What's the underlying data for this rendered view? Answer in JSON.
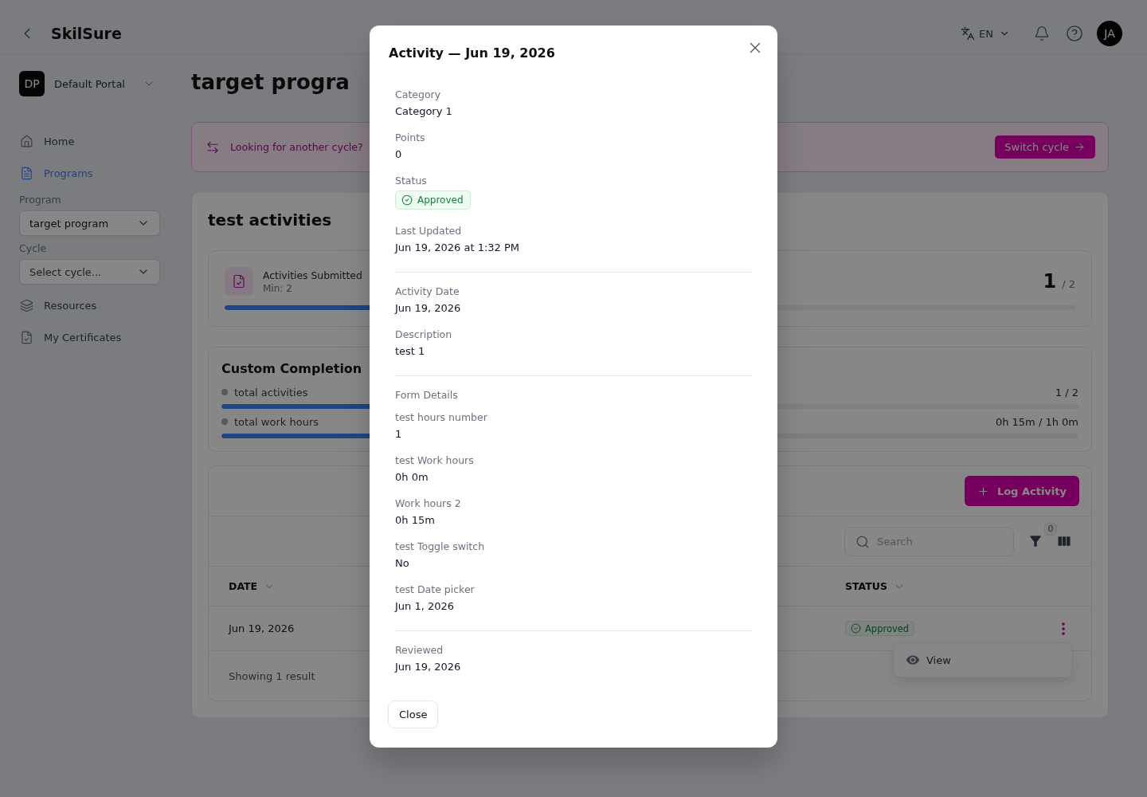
{
  "header": {
    "brand": "SkilSure",
    "language": "EN",
    "avatar": "JA"
  },
  "sidebar": {
    "portal": {
      "initials": "DP",
      "name": "Default Portal"
    },
    "items": [
      {
        "kind": "link",
        "label": "Home",
        "selected": false
      },
      {
        "kind": "link",
        "label": "Programs",
        "selected": true
      },
      {
        "kind": "select",
        "label": "Program",
        "value": "target program"
      },
      {
        "kind": "select",
        "label": "Cycle",
        "placeholder": "Select cycle..."
      },
      {
        "kind": "link",
        "label": "Resources",
        "selected": false
      },
      {
        "kind": "link",
        "label": "My Certificates",
        "selected": false
      }
    ]
  },
  "page_title": "target progra",
  "banner": {
    "text": "Looking for another cycle?",
    "button": "Switch cycle"
  },
  "section": {
    "title": "test activities",
    "requirement": {
      "title": "Activities Submitted",
      "subtitle": "Min: 2",
      "count": "1",
      "target": "/ 2",
      "level": 0.5
    },
    "custom_completion": {
      "title": "Custom Completion",
      "items": [
        {
          "label": "total activities",
          "done": false,
          "reading": "1 / 2",
          "level": 0.5
        },
        {
          "label": "total work hours",
          "done": false,
          "reading": "0h 15m / 1h 0m",
          "level": 0.25
        }
      ]
    },
    "table": {
      "button": "Log Activity",
      "search": {
        "placeholder": "Search"
      },
      "filter_count": "0",
      "columns": [
        {
          "label": "DATE"
        },
        {
          "label": "STATUS"
        }
      ],
      "rows": [
        {
          "date": "Jun 19, 2026",
          "status": "Approved"
        }
      ],
      "row_menu": [
        "View"
      ],
      "footer": "Showing 1 result"
    }
  },
  "dialog": {
    "title": "Activity — Jun 19, 2026",
    "sections": [
      {
        "fields": [
          {
            "kind": "text",
            "label": "Category",
            "value": "Category 1"
          },
          {
            "kind": "text",
            "label": "Points",
            "value": "0"
          },
          {
            "kind": "badge",
            "label": "Status",
            "value": "Approved"
          },
          {
            "kind": "text",
            "label": "Last Updated",
            "value": "Jun 19, 2026 at 1:32 PM"
          }
        ]
      },
      {
        "fields": [
          {
            "kind": "text",
            "label": "Activity Date",
            "value": "Jun 19, 2026"
          },
          {
            "kind": "text",
            "label": "Description",
            "value": "test 1"
          }
        ]
      },
      {
        "heading": "Form Details",
        "fields": [
          {
            "kind": "text",
            "label": "test hours number",
            "value": "1"
          },
          {
            "kind": "text",
            "label": "test Work hours",
            "value": "0h 0m"
          },
          {
            "kind": "text",
            "label": "Work hours 2",
            "value": "0h 15m"
          },
          {
            "kind": "text",
            "label": "test Toggle switch",
            "value": "No"
          },
          {
            "kind": "text",
            "label": "test Date picker",
            "value": "Jun 1, 2026"
          }
        ]
      },
      {
        "fields": [
          {
            "kind": "text",
            "label": "Reviewed",
            "value": "Jun 19, 2026"
          }
        ]
      }
    ],
    "button": "Close"
  }
}
